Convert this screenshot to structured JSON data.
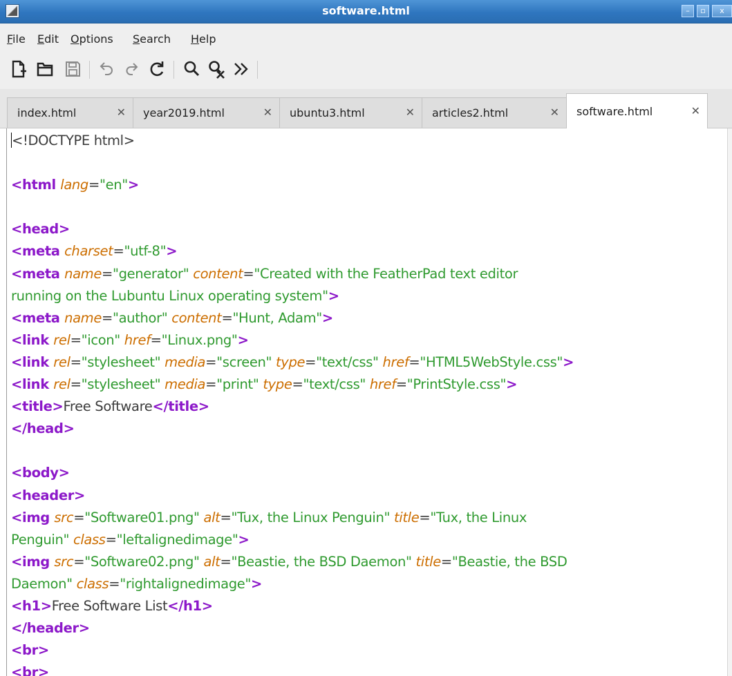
{
  "window": {
    "title": "software.html",
    "controls": {
      "minimize": "–",
      "maximize": "▫",
      "close": "x"
    }
  },
  "menu": [
    {
      "mnemonic": "F",
      "rest": "ile"
    },
    {
      "mnemonic": "E",
      "rest": "dit"
    },
    {
      "mnemonic": "O",
      "rest": "ptions"
    },
    {
      "mnemonic": "S",
      "rest": "earch"
    },
    {
      "mnemonic": "H",
      "rest": "elp"
    }
  ],
  "toolbar": {
    "icons": [
      "new-file-icon",
      "open-folder-icon",
      "save-icon",
      "undo-icon",
      "redo-icon",
      "reload-icon",
      "find-icon",
      "replace-icon",
      "more-icon"
    ]
  },
  "tabs": [
    {
      "label": "index.html",
      "close": "✕",
      "active": false
    },
    {
      "label": "year2019.html",
      "close": "✕",
      "active": false
    },
    {
      "label": "ubuntu3.html",
      "close": "✕",
      "active": false
    },
    {
      "label": "articles2.html",
      "close": "✕",
      "active": false
    },
    {
      "label": "software.html",
      "close": "✕",
      "active": true
    }
  ],
  "editor": {
    "lines": [
      [
        [
          "tx",
          "<!DOCTYPE html>"
        ]
      ],
      [],
      [
        [
          "tg",
          "<html "
        ],
        [
          "at",
          "lang"
        ],
        [
          "tx",
          "="
        ],
        [
          "vl",
          "\"en\""
        ],
        [
          "tg",
          ">"
        ]
      ],
      [],
      [
        [
          "tg",
          "<head>"
        ]
      ],
      [
        [
          "tg",
          "<meta "
        ],
        [
          "at",
          "charset"
        ],
        [
          "tx",
          "="
        ],
        [
          "vl",
          "\"utf-8\""
        ],
        [
          "tg",
          ">"
        ]
      ],
      [
        [
          "tg",
          "<meta "
        ],
        [
          "at",
          "name"
        ],
        [
          "tx",
          "="
        ],
        [
          "vl",
          "\"generator\" "
        ],
        [
          "at",
          "content"
        ],
        [
          "tx",
          "="
        ],
        [
          "vl",
          "\"Created with the FeatherPad text editor"
        ]
      ],
      [
        [
          "vl",
          "running on the Lubuntu Linux operating system\""
        ],
        [
          "tg",
          ">"
        ]
      ],
      [
        [
          "tg",
          "<meta "
        ],
        [
          "at",
          "name"
        ],
        [
          "tx",
          "="
        ],
        [
          "vl",
          "\"author\" "
        ],
        [
          "at",
          "content"
        ],
        [
          "tx",
          "="
        ],
        [
          "vl",
          "\"Hunt, Adam\""
        ],
        [
          "tg",
          ">"
        ]
      ],
      [
        [
          "tg",
          "<link "
        ],
        [
          "at",
          "rel"
        ],
        [
          "tx",
          "="
        ],
        [
          "vl",
          "\"icon\" "
        ],
        [
          "at",
          "href"
        ],
        [
          "tx",
          "="
        ],
        [
          "vl",
          "\"Linux.png\""
        ],
        [
          "tg",
          ">"
        ]
      ],
      [
        [
          "tg",
          "<link "
        ],
        [
          "at",
          "rel"
        ],
        [
          "tx",
          "="
        ],
        [
          "vl",
          "\"stylesheet\" "
        ],
        [
          "at",
          "media"
        ],
        [
          "tx",
          "="
        ],
        [
          "vl",
          "\"screen\" "
        ],
        [
          "at",
          "type"
        ],
        [
          "tx",
          "="
        ],
        [
          "vl",
          "\"text/css\" "
        ],
        [
          "at",
          "href"
        ],
        [
          "tx",
          "="
        ],
        [
          "vl",
          "\"HTML5WebStyle.css\""
        ],
        [
          "tg",
          ">"
        ]
      ],
      [
        [
          "tg",
          "<link "
        ],
        [
          "at",
          "rel"
        ],
        [
          "tx",
          "="
        ],
        [
          "vl",
          "\"stylesheet\" "
        ],
        [
          "at",
          "media"
        ],
        [
          "tx",
          "="
        ],
        [
          "vl",
          "\"print\" "
        ],
        [
          "at",
          "type"
        ],
        [
          "tx",
          "="
        ],
        [
          "vl",
          "\"text/css\" "
        ],
        [
          "at",
          "href"
        ],
        [
          "tx",
          "="
        ],
        [
          "vl",
          "\"PrintStyle.css\""
        ],
        [
          "tg",
          ">"
        ]
      ],
      [
        [
          "tg",
          "<title>"
        ],
        [
          "tx",
          "Free Software"
        ],
        [
          "tg",
          "</title>"
        ]
      ],
      [
        [
          "tg",
          "</head>"
        ]
      ],
      [],
      [
        [
          "tg",
          "<body>"
        ]
      ],
      [
        [
          "tg",
          "<header>"
        ]
      ],
      [
        [
          "tg",
          "<img "
        ],
        [
          "at",
          "src"
        ],
        [
          "tx",
          "="
        ],
        [
          "vl",
          "\"Software01.png\" "
        ],
        [
          "at",
          "alt"
        ],
        [
          "tx",
          "="
        ],
        [
          "vl",
          "\"Tux, the Linux Penguin\" "
        ],
        [
          "at",
          "title"
        ],
        [
          "tx",
          "="
        ],
        [
          "vl",
          "\"Tux, the Linux"
        ]
      ],
      [
        [
          "vl",
          "Penguin\" "
        ],
        [
          "at",
          "class"
        ],
        [
          "tx",
          "="
        ],
        [
          "vl",
          "\"leftalignedimage\""
        ],
        [
          "tg",
          ">"
        ]
      ],
      [
        [
          "tg",
          "<img "
        ],
        [
          "at",
          "src"
        ],
        [
          "tx",
          "="
        ],
        [
          "vl",
          "\"Software02.png\" "
        ],
        [
          "at",
          "alt"
        ],
        [
          "tx",
          "="
        ],
        [
          "vl",
          "\"Beastie, the BSD Daemon\" "
        ],
        [
          "at",
          "title"
        ],
        [
          "tx",
          "="
        ],
        [
          "vl",
          "\"Beastie, the BSD"
        ]
      ],
      [
        [
          "vl",
          "Daemon\" "
        ],
        [
          "at",
          "class"
        ],
        [
          "tx",
          "="
        ],
        [
          "vl",
          "\"rightalignedimage\""
        ],
        [
          "tg",
          ">"
        ]
      ],
      [
        [
          "tg",
          "<h1>"
        ],
        [
          "tx",
          "Free Software List"
        ],
        [
          "tg",
          "</h1>"
        ]
      ],
      [
        [
          "tg",
          "</header>"
        ]
      ],
      [
        [
          "tg",
          "<br>"
        ]
      ],
      [
        [
          "tg",
          "<br>"
        ]
      ]
    ]
  }
}
